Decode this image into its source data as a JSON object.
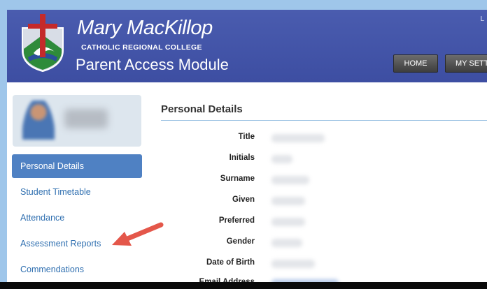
{
  "header": {
    "school_name": "Mary MacKillop",
    "school_subtitle": "CATHOLIC REGIONAL COLLEGE",
    "module_title": "Parent Access Module",
    "corner_glyph": "L",
    "nav": [
      {
        "label": "HOME"
      },
      {
        "label": "MY SETT"
      }
    ],
    "crest_colors": {
      "shield": "#d8dde6",
      "cross": "#c42a2a",
      "green": "#2e8b3a",
      "blue": "#2a4f9a"
    }
  },
  "sidebar": {
    "items": [
      {
        "label": "Personal Details",
        "active": true
      },
      {
        "label": "Student Timetable",
        "active": false
      },
      {
        "label": "Attendance",
        "active": false
      },
      {
        "label": "Assessment Reports",
        "active": false
      },
      {
        "label": "Commendations",
        "active": false
      }
    ],
    "annotation": {
      "icon": "arrow-pointer-icon",
      "color": "#e4574a",
      "points_to": "Assessment Reports"
    }
  },
  "content": {
    "title": "Personal Details",
    "fields": [
      {
        "label": "Title"
      },
      {
        "label": "Initials"
      },
      {
        "label": "Surname"
      },
      {
        "label": "Given"
      },
      {
        "label": "Preferred"
      },
      {
        "label": "Gender"
      },
      {
        "label": "Date of Birth"
      },
      {
        "label": "Email Address"
      }
    ]
  },
  "colors": {
    "header_bg": "#3d4ea2",
    "active_item": "#4f81c3",
    "link": "#2f6fb0",
    "divider": "#9ec4e4",
    "page_border": "#9fc6ea"
  }
}
